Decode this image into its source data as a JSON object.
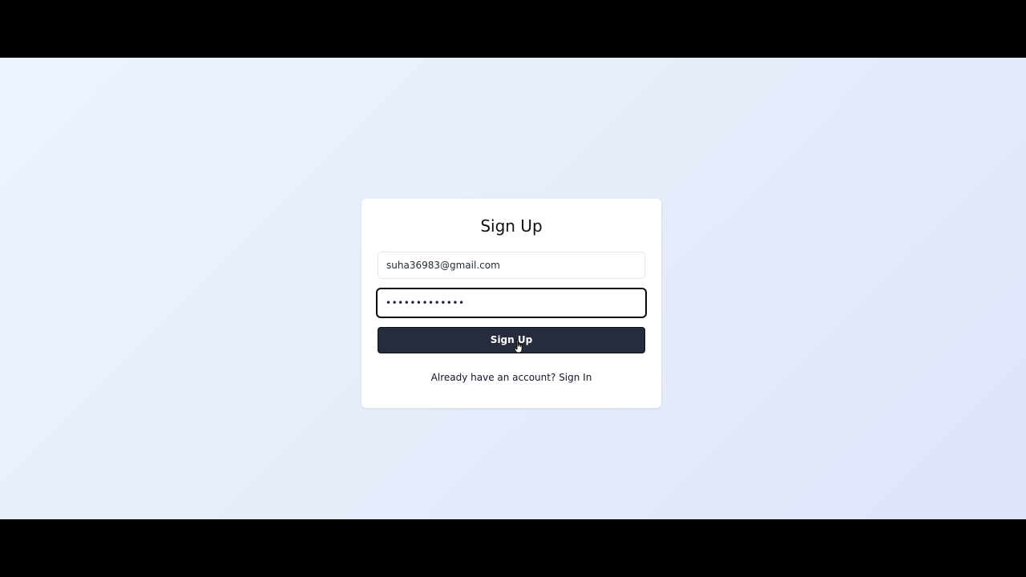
{
  "form": {
    "title": "Sign Up",
    "email_value": "suha36983@gmail.com",
    "password_value": "•••••••••••••",
    "submit_label": "Sign Up",
    "signin_prompt": "Already have an account?",
    "signin_link": "Sign In"
  },
  "colors": {
    "button_bg": "#262c3c",
    "page_bg_start": "#eef4fd",
    "page_bg_end": "#dfe5fa"
  },
  "icons": {
    "cursor": "hand-pointer-icon"
  }
}
